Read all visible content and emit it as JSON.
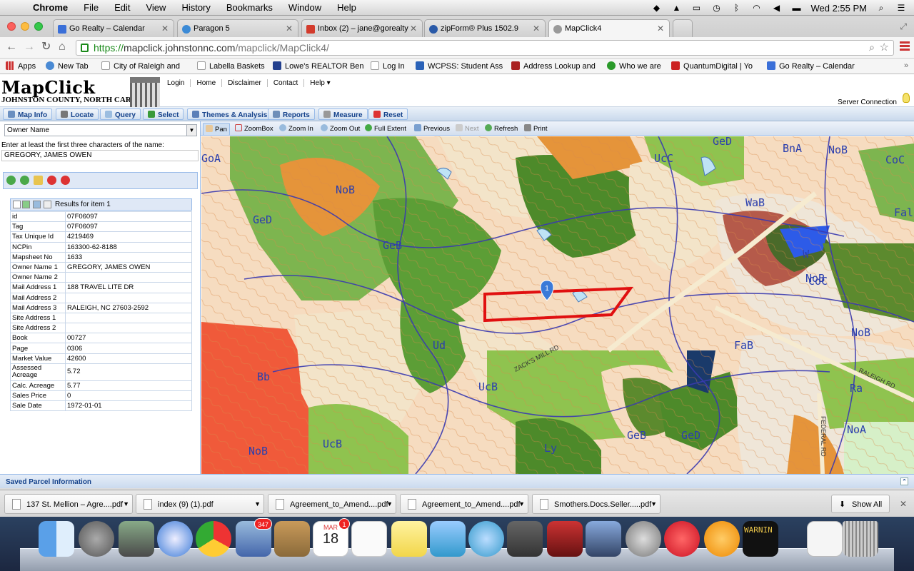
{
  "menubar": {
    "app": "Chrome",
    "items": [
      "File",
      "Edit",
      "View",
      "History",
      "Bookmarks",
      "Window",
      "Help"
    ],
    "clock": "Wed 2:55 PM"
  },
  "tabs": [
    {
      "label": "Go Realty – Calendar",
      "color": "#3a6fd8"
    },
    {
      "label": "Paragon 5",
      "color": "#3b8ad6"
    },
    {
      "label": "Inbox (2) – jane@gorealty",
      "color": "#d33b2c"
    },
    {
      "label": "zipForm® Plus 1502.9",
      "color": "#2a5aa8"
    },
    {
      "label": "MapClick4",
      "color": "#8a8a8a"
    }
  ],
  "address": {
    "scheme": "https://",
    "host": "mapclick.johnstonnc.com",
    "path": "/mapclick/MapClick4/"
  },
  "bookmarks": [
    {
      "label": "Apps",
      "color": "#c33"
    },
    {
      "label": "New Tab",
      "color": "#4a8ad4"
    },
    {
      "label": "City of Raleigh and",
      "color": "#ddd"
    },
    {
      "label": "Labella Baskets",
      "color": "#ddd"
    },
    {
      "label": "Lowe's REALTOR Ben",
      "color": "#23408e"
    },
    {
      "label": "Log In",
      "color": "#ddd"
    },
    {
      "label": "WCPSS: Student Ass",
      "color": "#2a62b8"
    },
    {
      "label": "Address Lookup and",
      "color": "#a22"
    },
    {
      "label": "Who we are",
      "color": "#2a9a2a"
    },
    {
      "label": "QuantumDigital | Yo",
      "color": "#c22"
    },
    {
      "label": "Go Realty – Calendar",
      "color": "#3a6fd8"
    }
  ],
  "mapclick": {
    "logo_title": "MapClick",
    "logo_subtitle": "JOHNSTON COUNTY, NORTH CAROLINA",
    "nav": [
      "Login",
      "Home",
      "Disclaimer",
      "Contact",
      "Help ▾"
    ],
    "server": "Server Connection",
    "toolbar": [
      "Map Info",
      "Locate",
      "Query",
      "Select",
      "Themes & Analysis",
      "Reports",
      "Measure",
      "Reset"
    ],
    "search_field": "Owner Name",
    "hint": "Enter at least the first three characters of the name:",
    "name_value": "GREGORY, JAMES OWEN",
    "results_title": "Results for item 1",
    "results": [
      {
        "k": "id",
        "v": "07F06097"
      },
      {
        "k": "Tag",
        "v": "07F06097"
      },
      {
        "k": "Tax Unique Id",
        "v": "4219469"
      },
      {
        "k": "NCPin",
        "v": "163300-62-8188"
      },
      {
        "k": "Mapsheet No",
        "v": "1633"
      },
      {
        "k": "Owner Name 1",
        "v": "GREGORY, JAMES OWEN"
      },
      {
        "k": "Owner Name 2",
        "v": ""
      },
      {
        "k": "Mail Address 1",
        "v": "188 TRAVEL LITE DR"
      },
      {
        "k": "Mail Address 2",
        "v": ""
      },
      {
        "k": "Mail Address 3",
        "v": "RALEIGH, NC 27603-2592"
      },
      {
        "k": "Site Address 1",
        "v": ""
      },
      {
        "k": "Site Address 2",
        "v": ""
      },
      {
        "k": "Book",
        "v": "00727"
      },
      {
        "k": "Page",
        "v": "0306"
      },
      {
        "k": "Market Value",
        "v": "42600"
      },
      {
        "k": "Assessed Acreage",
        "v": "5.72"
      },
      {
        "k": "Calc. Acreage",
        "v": "5.77"
      },
      {
        "k": "Sales Price",
        "v": "0"
      },
      {
        "k": "Sale Date",
        "v": "1972-01-01"
      }
    ],
    "map_tools": [
      "Pan",
      "ZoomBox",
      "Zoom In",
      "Zoom Out",
      "Full Extent",
      "Previous",
      "Next",
      "Refresh",
      "Print"
    ],
    "saved": "Saved Parcel Information",
    "map_labels": [
      "GoA",
      "GeD",
      "NoB",
      "GeB",
      "UcC",
      "GeD",
      "BnA",
      "NoB",
      "CoC",
      "Fal",
      "WaB",
      "NoB",
      "W",
      "CoC",
      "FaB",
      "NoB",
      "Ud",
      "UcB",
      "Bb",
      "Ra",
      "UcB",
      "GeB",
      "GeD",
      "NoA",
      "Ly",
      "NoB",
      "ZACK'S MILL RD",
      "RALEIGH RD",
      "FEDERAL RD",
      "1"
    ]
  },
  "downloads": [
    "137 St. Mellion – Agre....pdf",
    "index (9) (1).pdf",
    "Agreement_to_Amend....pdf",
    "Agreement_to_Amend....pdf",
    "Smothers.Docs.Seller.....pdf"
  ],
  "show_all": "Show All",
  "dock": {
    "mail_badge": "347",
    "calendar_badge": "1",
    "calendar_month": "MAR",
    "calendar_day": "18",
    "console_text": "WARNIN"
  }
}
